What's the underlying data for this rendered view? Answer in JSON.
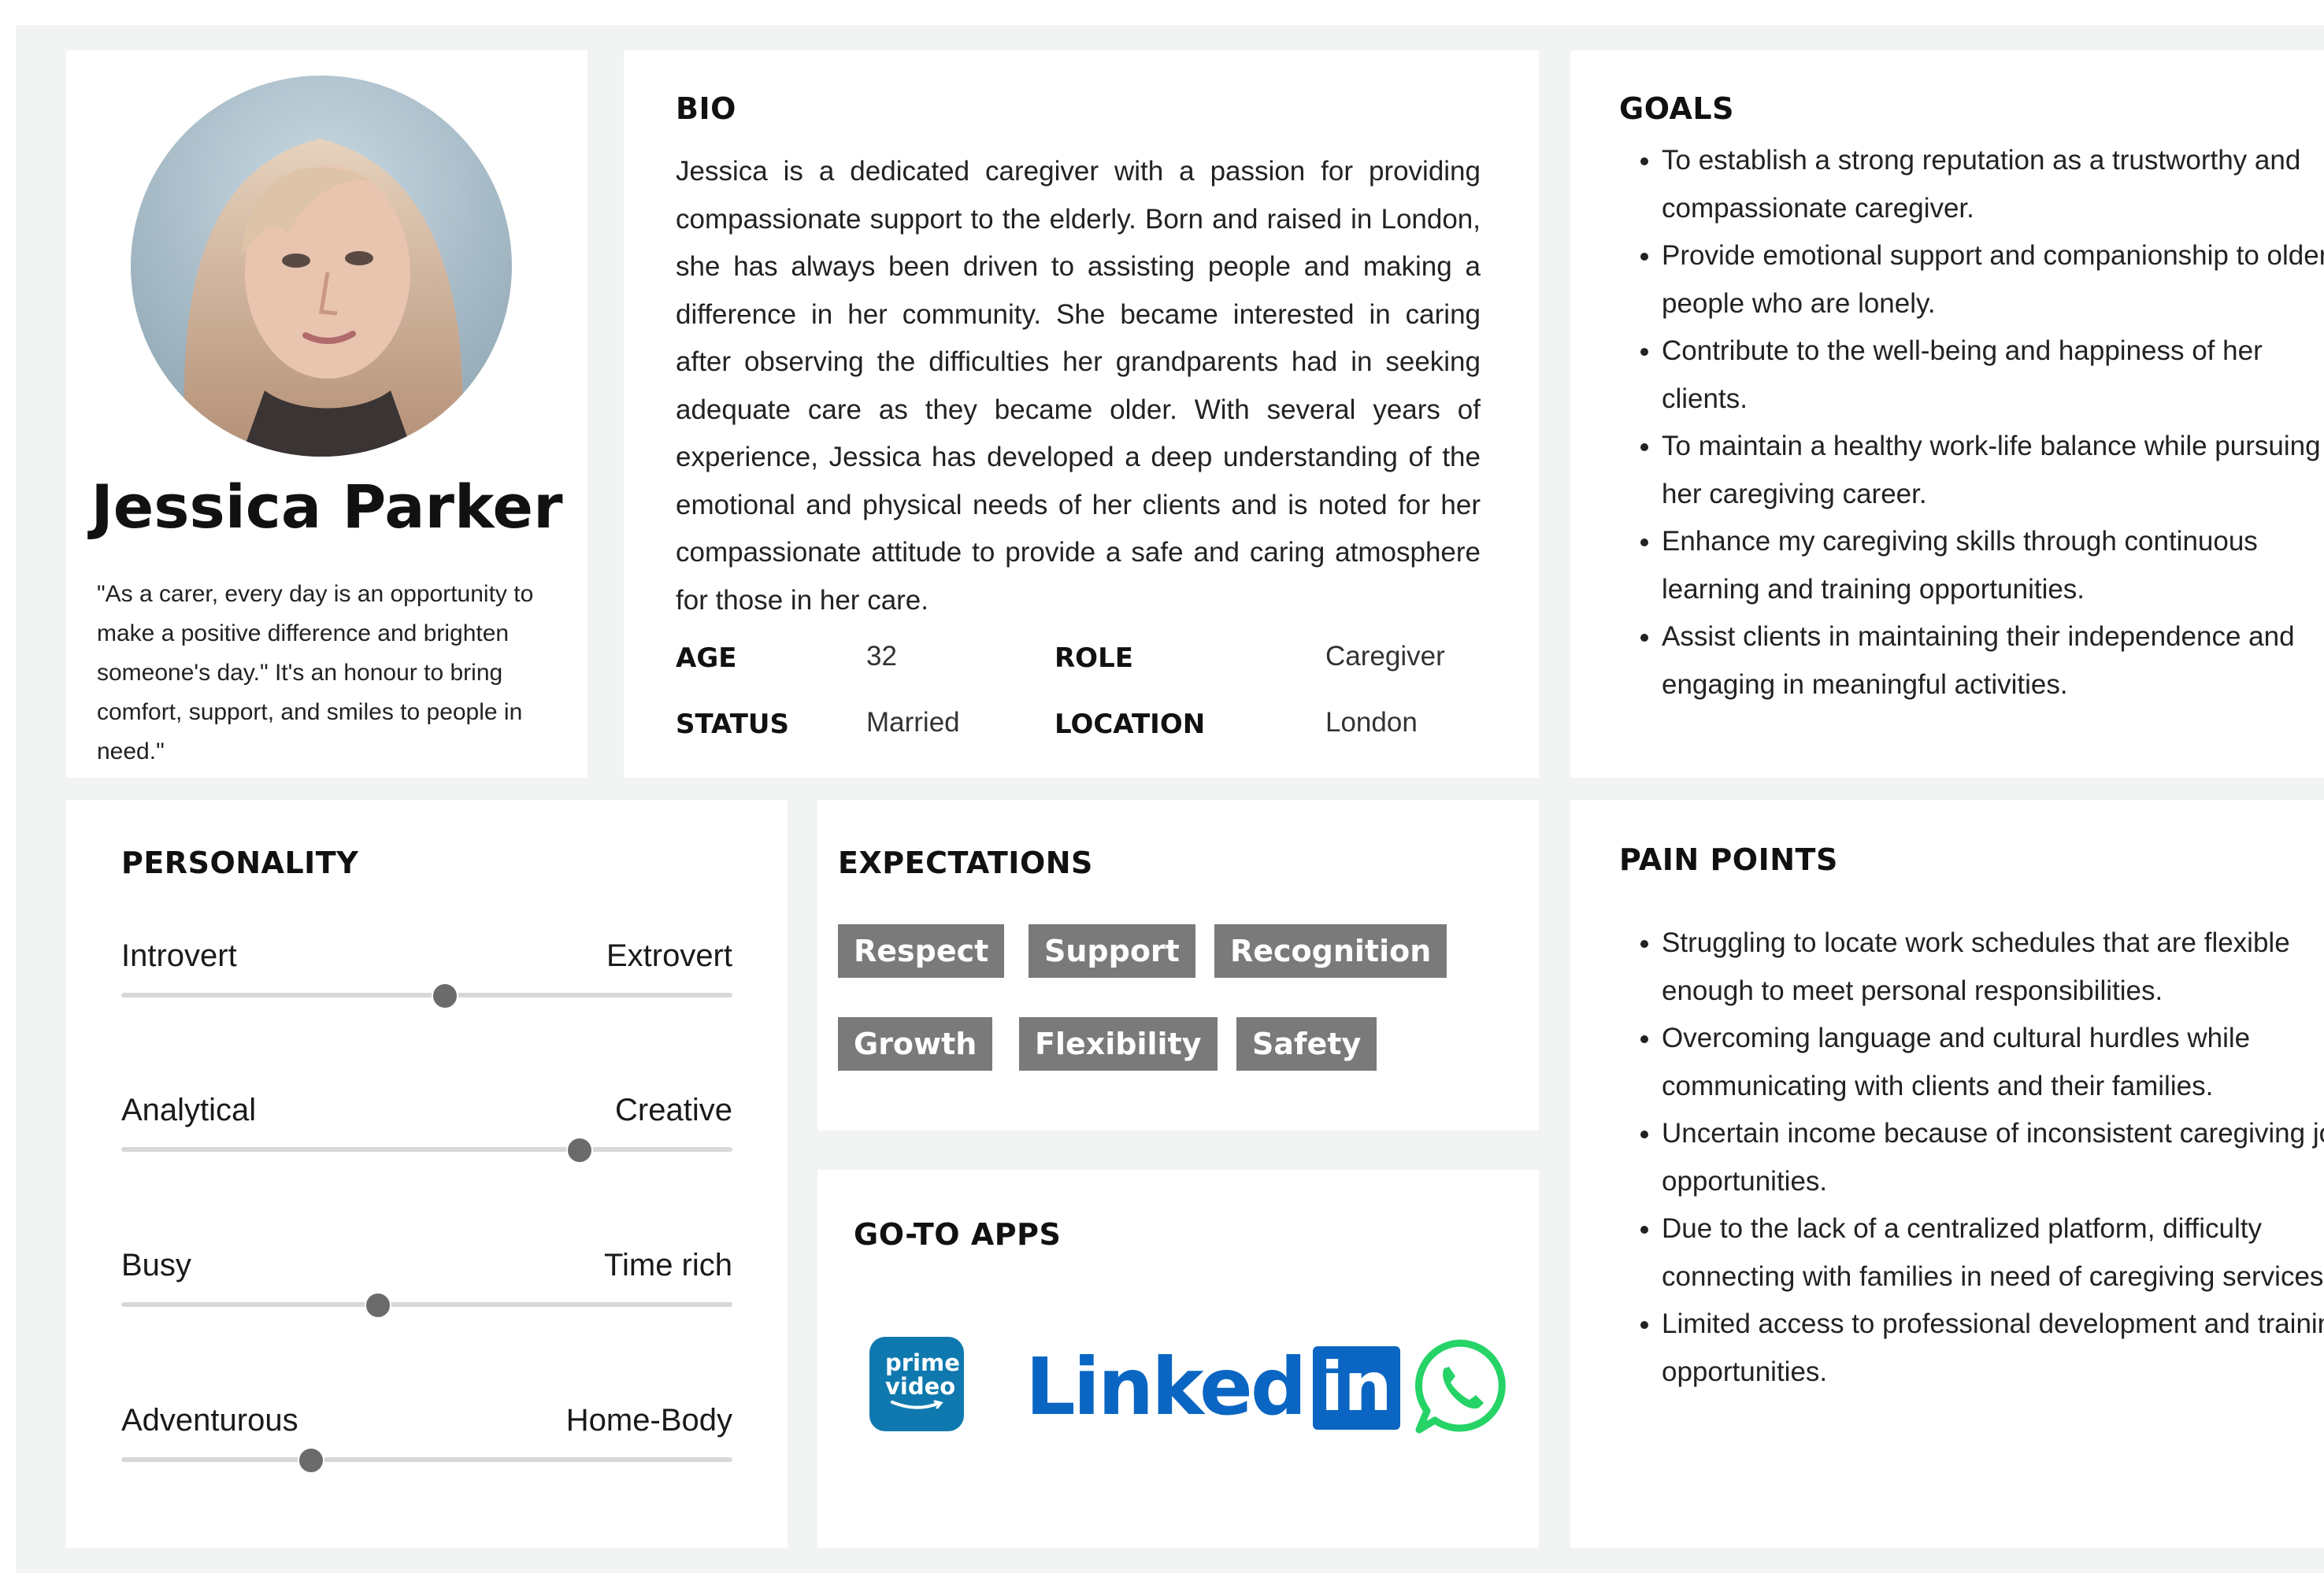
{
  "profile": {
    "name": "Jessica Parker",
    "quote": "\"As a carer, every day is an opportunity to make a positive difference and brighten someone's day.\" It's an honour to bring comfort, support, and smiles to people in need.\""
  },
  "bio": {
    "heading": "BIO",
    "text": "Jessica is a dedicated caregiver with a passion for providing compassionate support to the elderly. Born and raised in London, she has always been driven to assisting people and making a difference in her community. She became interested in caring after observing the difficulties her grandparents had in seeking adequate care as they became older. With several years of experience, Jessica has developed a deep understanding of the emotional and physical needs of her clients and is noted for her compassionate attitude to provide a safe and caring atmosphere for those in her care.",
    "facts": {
      "age_label": "AGE",
      "age_value": "32",
      "role_label": "ROLE",
      "role_value": "Caregiver",
      "status_label": "STATUS",
      "status_value": "Married",
      "location_label": "LOCATION",
      "location_value": "London"
    }
  },
  "goals": {
    "heading": "GOALS",
    "items": [
      "To establish a strong reputation as a trustworthy and compassionate caregiver.",
      "Provide emotional support and companionship to older people who are lonely.",
      "Contribute to the well-being and happiness of her clients.",
      "To maintain a healthy work-life balance while pursuing her caregiving career.",
      "Enhance my caregiving skills through continuous learning and training opportunities.",
      "Assist clients in maintaining their independence and engaging in meaningful activities."
    ]
  },
  "personality": {
    "heading": "PERSONALITY",
    "traits": [
      {
        "left": "Introvert",
        "right": "Extrovert",
        "level": 0.53
      },
      {
        "left": "Analytical",
        "right": "Creative",
        "level": 0.75
      },
      {
        "left": "Busy",
        "right": "Time rich",
        "level": 0.42
      },
      {
        "left": "Adventurous",
        "right": "Home-Body",
        "level": 0.31
      }
    ]
  },
  "expectations": {
    "heading": "EXPECTATIONS",
    "tags": [
      "Respect",
      "Support",
      "Recognition",
      "Growth",
      "Flexibility",
      "Safety"
    ]
  },
  "apps": {
    "heading": "GO-TO APPS",
    "items": [
      {
        "icon": "prime-video-icon",
        "label": "prime video",
        "color": "#0f79af"
      },
      {
        "icon": "linkedin-icon",
        "label": "Linked",
        "label_box": "in",
        "color": "#0a66c2"
      },
      {
        "icon": "whatsapp-icon",
        "color": "#25d366"
      }
    ]
  },
  "pain_points": {
    "heading": "PAIN POINTS",
    "items": [
      "Struggling to locate work schedules that are flexible enough to meet personal responsibilities.",
      "Overcoming language and cultural hurdles while communicating with clients and their families.",
      "Uncertain income because of inconsistent caregiving job opportunities.",
      "Due to the lack of a centralized platform, difficulty connecting with families in need of caregiving services.",
      "Limited access to professional development and training opportunities."
    ]
  }
}
